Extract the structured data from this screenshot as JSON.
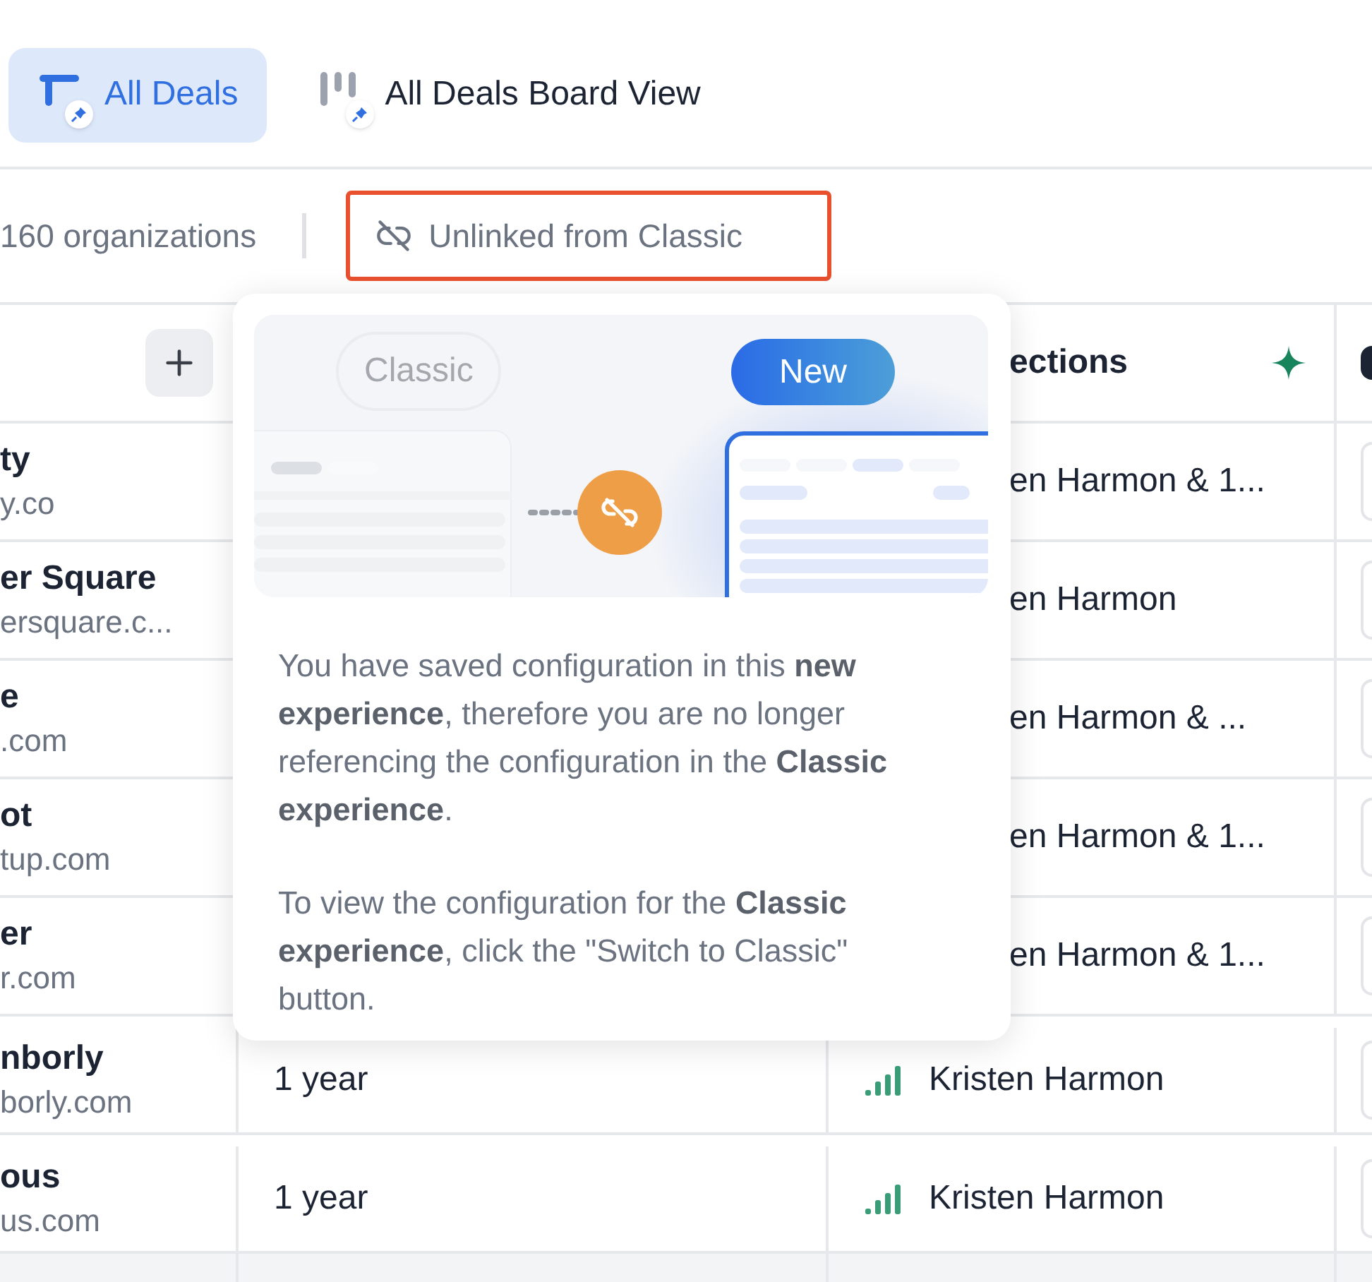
{
  "tabs": [
    {
      "label": "All Deals",
      "selected": true,
      "kind": "table"
    },
    {
      "label": "All Deals Board View",
      "selected": false,
      "kind": "board"
    }
  ],
  "toolbar": {
    "count": "160 organizations",
    "link_status": "Unlinked from Classic"
  },
  "table": {
    "column_3": "ections",
    "rows": [
      {
        "name": "ty",
        "domain": "y.co",
        "connection": "en Harmon & 1...",
        "signal": false
      },
      {
        "name": "er Square",
        "domain": "ersquare.c...",
        "connection": "en Harmon",
        "signal": false
      },
      {
        "name": "e",
        "domain": ".com",
        "connection": "en Harmon & ...",
        "signal": false
      },
      {
        "name": "ot",
        "domain": "tup.com",
        "connection": "en Harmon & 1...",
        "signal": false
      },
      {
        "name": "er",
        "domain": "r.com",
        "connection": "en Harmon & 1...",
        "signal": false
      },
      {
        "name": "nborly",
        "domain": "borly.com",
        "column_2": "1 year",
        "connection": "Kristen Harmon",
        "signal": true
      },
      {
        "name": "ous",
        "domain": "us.com",
        "column_2": "1 year",
        "connection": "Kristen Harmon",
        "signal": true
      }
    ]
  },
  "popover": {
    "old_label": "Classic",
    "new_label": "New",
    "paragraphs": [
      "You have saved configuration in this **new experience**, therefore you are no longer referencing the configuration in the **Classic experience**.",
      "To view the configuration for the **Classic experience**, click the \"Switch to Classic\" button."
    ]
  }
}
